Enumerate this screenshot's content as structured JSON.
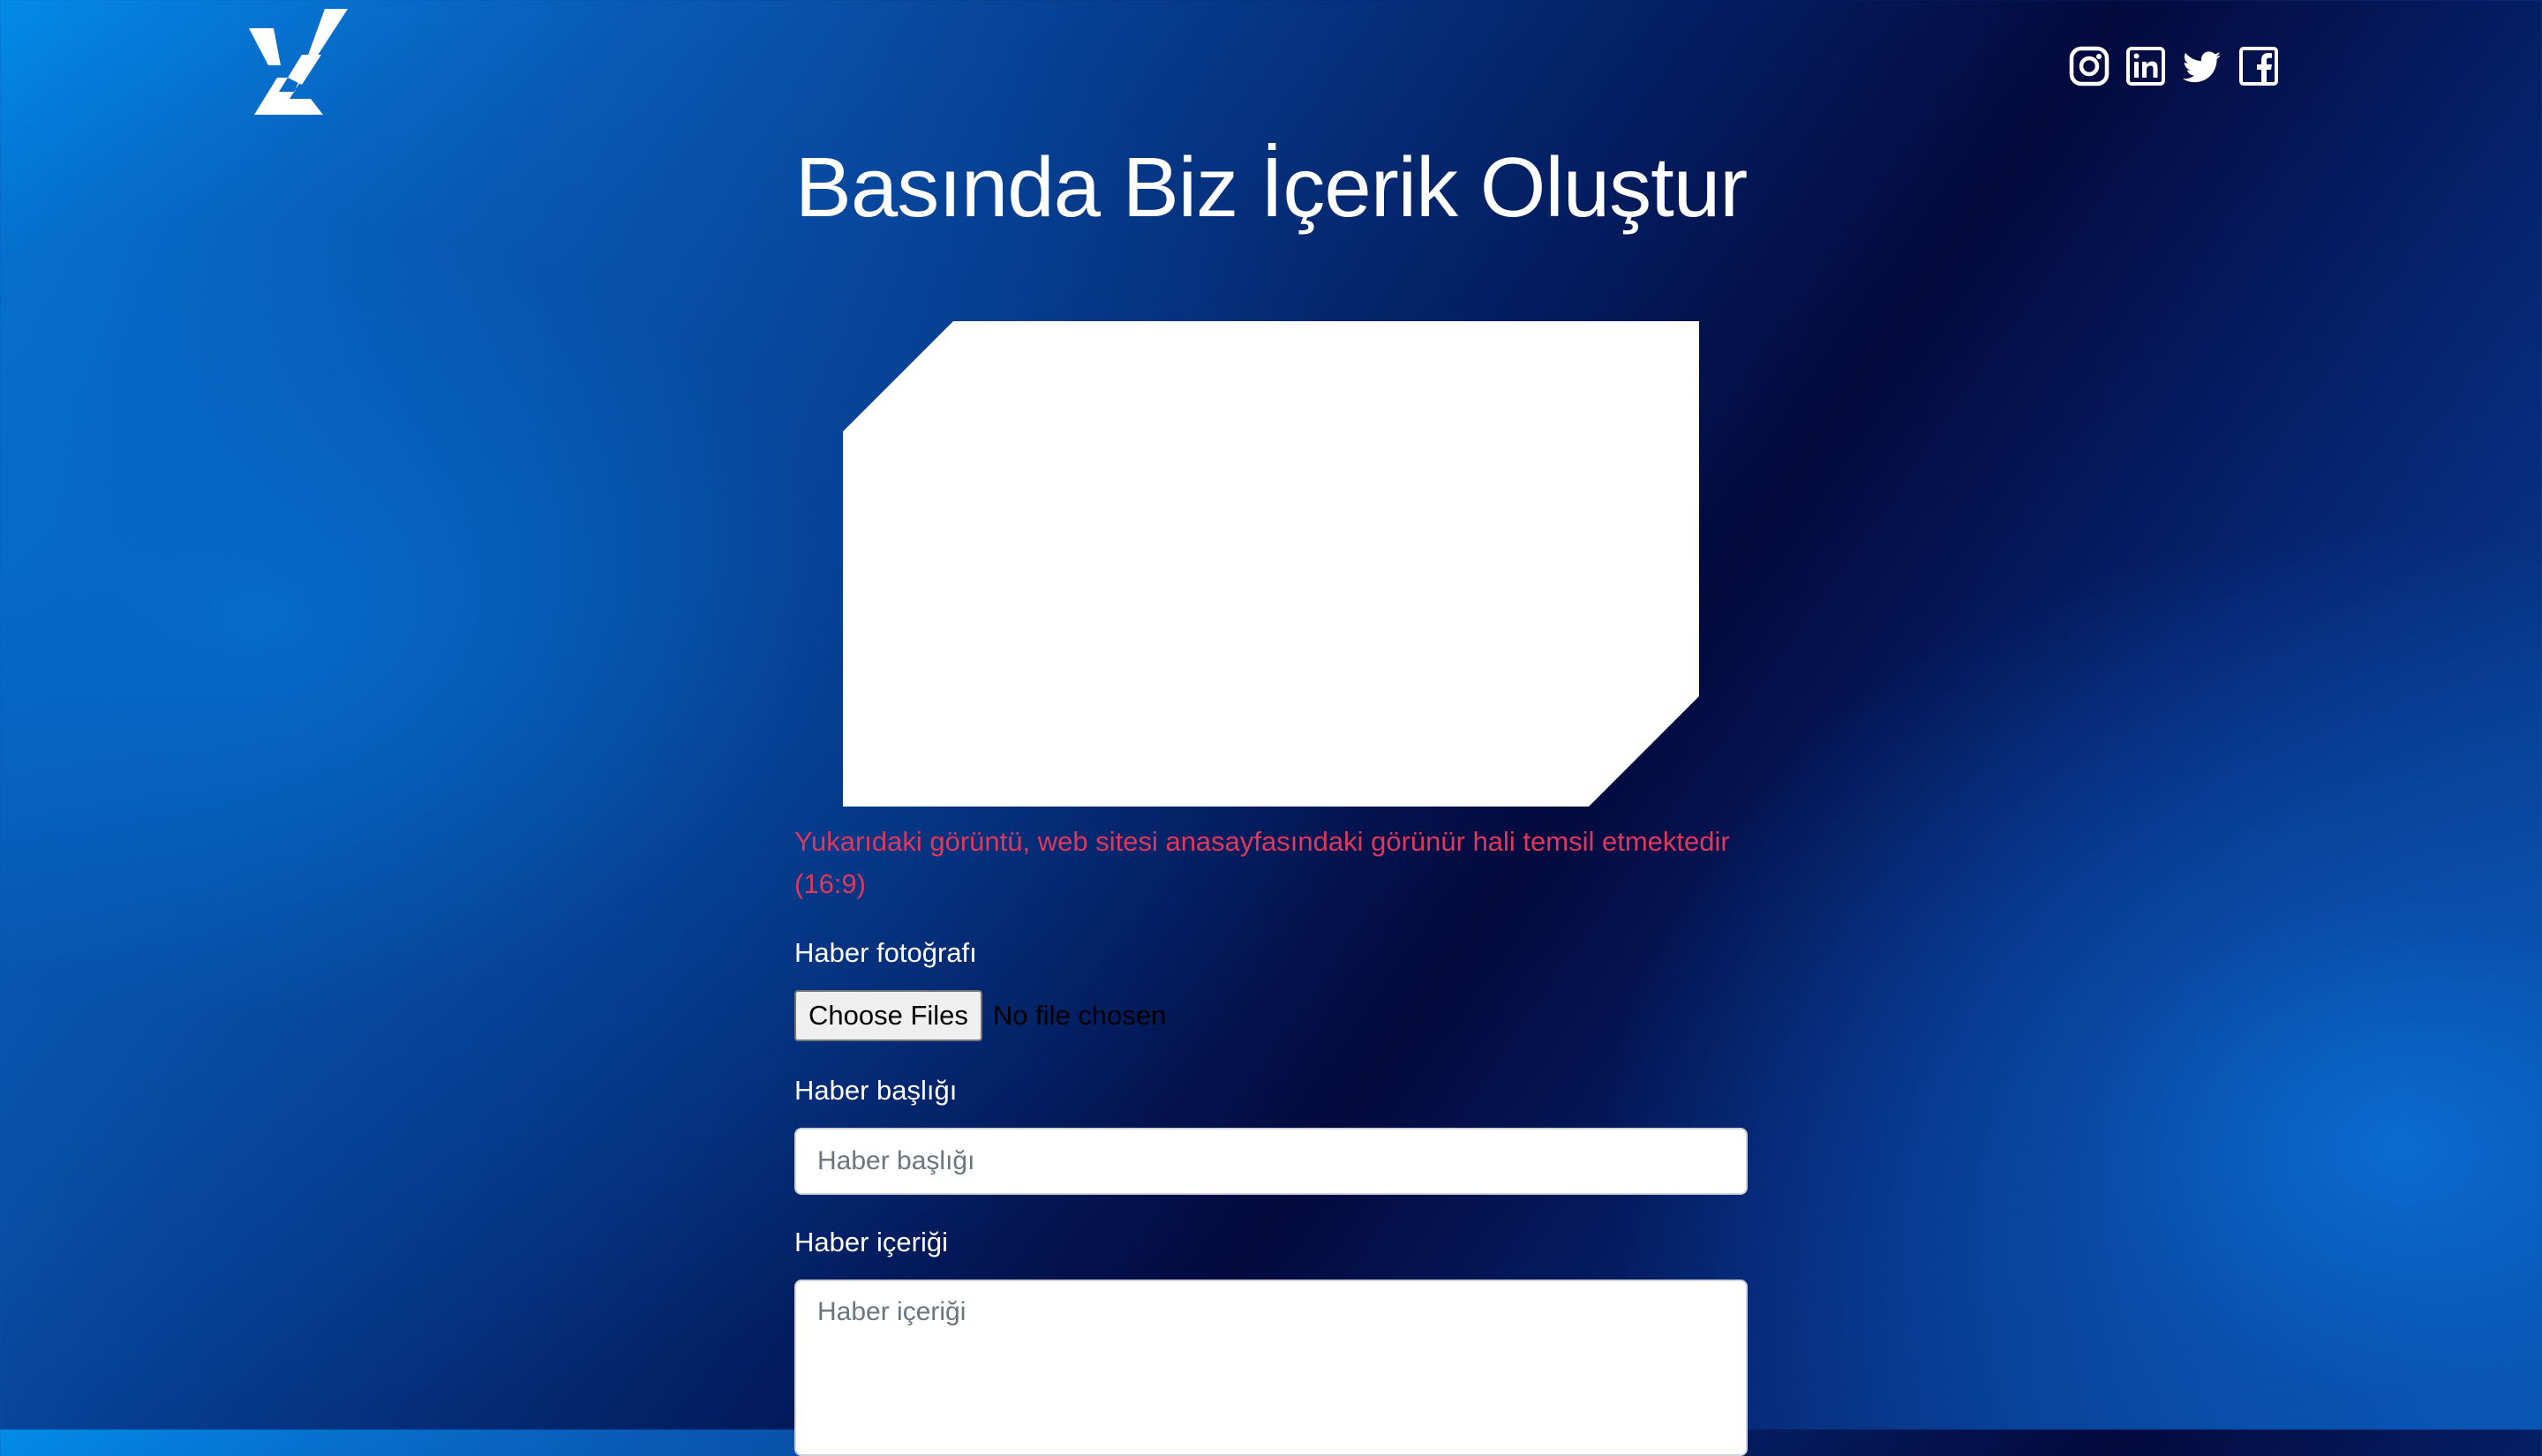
{
  "header": {
    "social_icons": [
      "instagram-icon",
      "linkedin-icon",
      "twitter-icon",
      "facebook-icon"
    ]
  },
  "page": {
    "title": "Basında Biz İçerik Oluştur"
  },
  "form": {
    "notice": "Yukarıdaki görüntü, web sitesi anasayfasındaki görünür hali temsil etmektedir (16:9)",
    "photo_label": "Haber fotoğrafı",
    "file_button_label": "Choose Files",
    "file_status": "No file chosen",
    "title_label": "Haber başlığı",
    "title_placeholder": "Haber başlığı",
    "content_label": "Haber içeriği",
    "content_placeholder": "Haber içeriği"
  },
  "colors": {
    "notice": "#e0385a",
    "background_light": "#0396f5",
    "background_dark": "#030a3e"
  }
}
